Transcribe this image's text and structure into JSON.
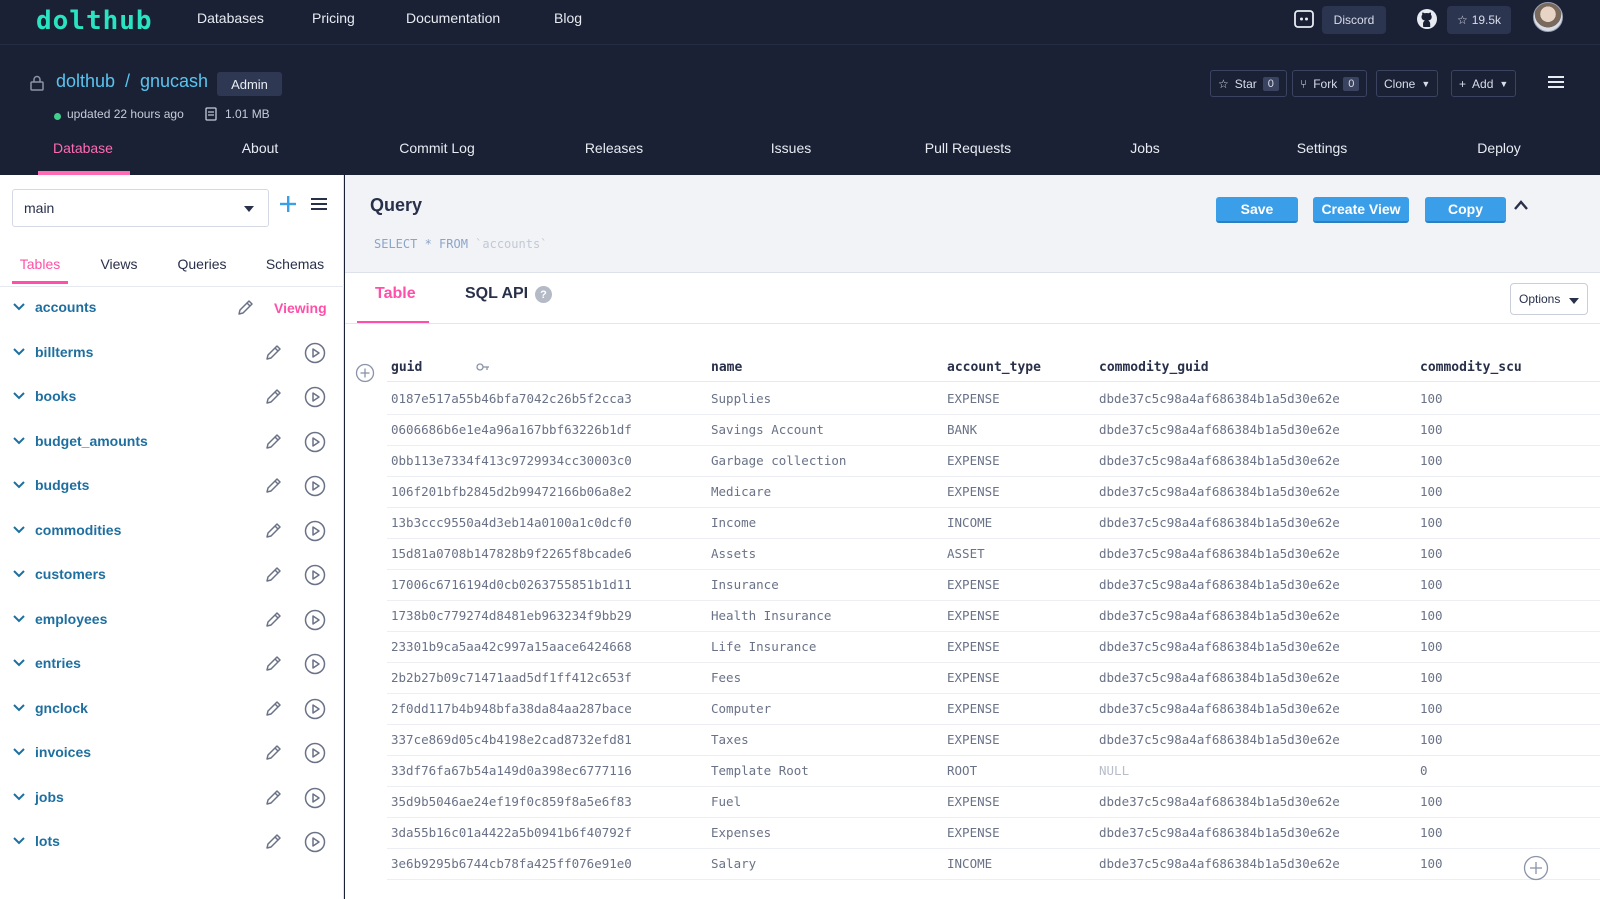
{
  "topbar": {
    "logo": "dolthub",
    "nav": [
      "Databases",
      "Pricing",
      "Documentation",
      "Blog"
    ],
    "discord_label": "Discord",
    "github_stars": "19.5k"
  },
  "repo": {
    "owner": "dolthub",
    "separator": "/",
    "name": "gnucash",
    "badge": "Admin",
    "updated": "updated 22 hours ago",
    "size": "1.01 MB",
    "star_label": "Star",
    "star_count": "0",
    "fork_label": "Fork",
    "fork_count": "0",
    "clone_label": "Clone",
    "add_label": "Add"
  },
  "tabs": [
    "Database",
    "About",
    "Commit Log",
    "Releases",
    "Issues",
    "Pull Requests",
    "Jobs",
    "Settings",
    "Deploy"
  ],
  "sidebar": {
    "branch": "main",
    "tabs": [
      "Tables",
      "Views",
      "Queries",
      "Schemas"
    ],
    "viewing_label": "Viewing",
    "tables": [
      "accounts",
      "billterms",
      "books",
      "budget_amounts",
      "budgets",
      "commodities",
      "customers",
      "employees",
      "entries",
      "gnclock",
      "invoices",
      "jobs",
      "lots"
    ]
  },
  "query": {
    "title": "Query",
    "sql_keywords": "SELECT * FROM",
    "sql_table": "`accounts`",
    "save_label": "Save",
    "create_view_label": "Create View",
    "copy_label": "Copy"
  },
  "results": {
    "tab_table": "Table",
    "tab_sql_api": "SQL API",
    "help": "?",
    "options_label": "Options",
    "columns": [
      "guid",
      "name",
      "account_type",
      "commodity_guid",
      "commodity_scu"
    ],
    "rows": [
      [
        "0187e517a55b46bfa7042c26b5f2cca3",
        "Supplies",
        "EXPENSE",
        "dbde37c5c98a4af686384b1a5d30e62e",
        "100"
      ],
      [
        "0606686b6e1e4a96a167bbf63226b1df",
        "Savings Account",
        "BANK",
        "dbde37c5c98a4af686384b1a5d30e62e",
        "100"
      ],
      [
        "0bb113e7334f413c9729934cc30003c0",
        "Garbage collection",
        "EXPENSE",
        "dbde37c5c98a4af686384b1a5d30e62e",
        "100"
      ],
      [
        "106f201bfb2845d2b99472166b06a8e2",
        "Medicare",
        "EXPENSE",
        "dbde37c5c98a4af686384b1a5d30e62e",
        "100"
      ],
      [
        "13b3ccc9550a4d3eb14a0100a1c0dcf0",
        "Income",
        "INCOME",
        "dbde37c5c98a4af686384b1a5d30e62e",
        "100"
      ],
      [
        "15d81a0708b147828b9f2265f8bcade6",
        "Assets",
        "ASSET",
        "dbde37c5c98a4af686384b1a5d30e62e",
        "100"
      ],
      [
        "17006c6716194d0cb0263755851b1d11",
        "Insurance",
        "EXPENSE",
        "dbde37c5c98a4af686384b1a5d30e62e",
        "100"
      ],
      [
        "1738b0c779274d8481eb963234f9bb29",
        "Health Insurance",
        "EXPENSE",
        "dbde37c5c98a4af686384b1a5d30e62e",
        "100"
      ],
      [
        "23301b9ca5aa42c997a15aace6424668",
        "Life Insurance",
        "EXPENSE",
        "dbde37c5c98a4af686384b1a5d30e62e",
        "100"
      ],
      [
        "2b2b27b09c71471aad5df1ff412c653f",
        "Fees",
        "EXPENSE",
        "dbde37c5c98a4af686384b1a5d30e62e",
        "100"
      ],
      [
        "2f0dd117b4b948bfa38da84aa287bace",
        "Computer",
        "EXPENSE",
        "dbde37c5c98a4af686384b1a5d30e62e",
        "100"
      ],
      [
        "337ce869d05c4b4198e2cad8732efd81",
        "Taxes",
        "EXPENSE",
        "dbde37c5c98a4af686384b1a5d30e62e",
        "100"
      ],
      [
        "33df76fa67b54a149d0a398ec6777116",
        "Template Root",
        "ROOT",
        "NULL",
        "0"
      ],
      [
        "35d9b5046ae24ef19f0c859f8a5e6f83",
        "Fuel",
        "EXPENSE",
        "dbde37c5c98a4af686384b1a5d30e62e",
        "100"
      ],
      [
        "3da55b16c01a4422a5b0941b6f40792f",
        "Expenses",
        "EXPENSE",
        "dbde37c5c98a4af686384b1a5d30e62e",
        "100"
      ],
      [
        "3e6b9295b6744cb78fa425ff076e91e0",
        "Salary",
        "INCOME",
        "dbde37c5c98a4af686384b1a5d30e62e",
        "100"
      ]
    ]
  }
}
